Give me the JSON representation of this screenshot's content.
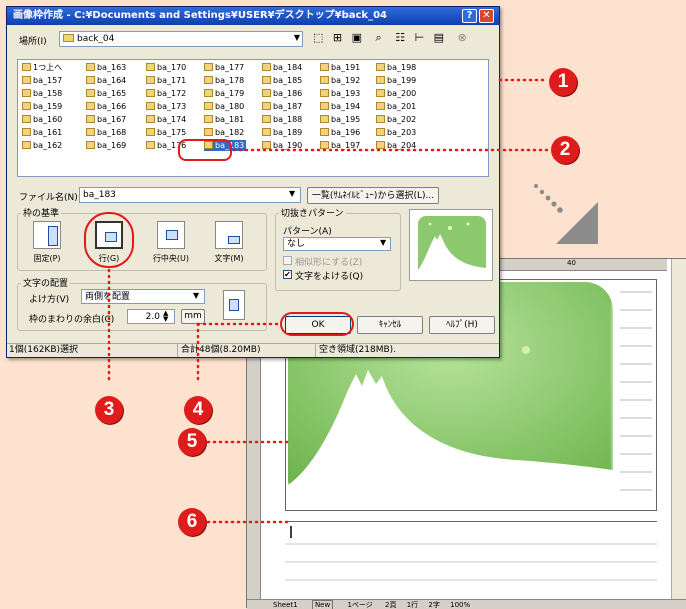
{
  "dialog": {
    "title": "画像枠作成 - C:¥Documents and Settings¥USER¥デスクトップ¥back_04",
    "help_btn": "?",
    "close_btn": "✕",
    "location_label": "場所(I)",
    "location_value": "back_04",
    "up_folder": "1つ上へ",
    "files": [
      [
        "ba_157",
        "ba_158",
        "ba_159",
        "ba_160",
        "ba_161",
        "ba_162"
      ],
      [
        "ba_163",
        "ba_164",
        "ba_165",
        "ba_166",
        "ba_167",
        "ba_168",
        "ba_169"
      ],
      [
        "ba_170",
        "ba_171",
        "ba_172",
        "ba_173",
        "ba_174",
        "ba_175",
        "ba_176"
      ],
      [
        "ba_177",
        "ba_178",
        "ba_179",
        "ba_180",
        "ba_181",
        "ba_182",
        "ba_183"
      ],
      [
        "ba_184",
        "ba_185",
        "ba_186",
        "ba_187",
        "ba_188",
        "ba_189",
        "ba_190"
      ],
      [
        "ba_191",
        "ba_192",
        "ba_193",
        "ba_194",
        "ba_195",
        "ba_196",
        "ba_197"
      ],
      [
        "ba_198",
        "ba_199",
        "ba_200",
        "ba_201",
        "ba_202",
        "ba_203",
        "ba_204"
      ]
    ],
    "selected_file": "ba_183",
    "filename_label": "ファイル名(N)",
    "filename_value": "ba_183",
    "list_select_btn": "一覧(ｻﾑﾈｲﾙﾋﾞｭｰ)から選択(L)...",
    "frame_basis": {
      "title": "枠の基準",
      "options": [
        "固定(P)",
        "行(G)",
        "行中央(U)",
        "文字(M)"
      ],
      "selected": "行(G)"
    },
    "text_layout": {
      "title": "文字の配置",
      "wrap_label": "よけ方(V)",
      "wrap_value": "両側を配置",
      "margin_label": "枠のまわりの余白(C)",
      "margin_value": "2.0",
      "margin_unit": "mm"
    },
    "clip_pattern": {
      "title": "切抜きパターン",
      "pattern_label": "パターン(A)",
      "pattern_value": "なし",
      "similar_label": "相似形にする(Z)",
      "avoid_label": "文字をよける(Q)"
    },
    "buttons": {
      "ok": "OK",
      "cancel": "ｷｬﾝｾﾙ",
      "help": "ﾍﾙﾌﾟ(H)"
    },
    "status": {
      "selected": "1個(162KB)選択",
      "total": "合計48個(8.20MB)",
      "free": "空き領域(218MB)."
    }
  },
  "document": {
    "ruler_mark": "40",
    "status_items": [
      "Sheet1",
      "New",
      "1ページ",
      "2頁",
      "1行",
      "2字",
      "100%"
    ]
  },
  "annotations": [
    "1",
    "2",
    "3",
    "4",
    "5",
    "6"
  ],
  "colors": {
    "accent": "#e01b1b",
    "title_bar": "#0f3fb0",
    "dialog_bg": "#ece9d8",
    "background": "#fde3cf",
    "preview_green": "#8cc96e"
  },
  "icons": [
    "help-icon",
    "close-icon",
    "folder-icon",
    "file-icon",
    "up-folder-icon",
    "dropdown-arrow-icon",
    "checkbox-icon",
    "frame-layout-icon"
  ]
}
